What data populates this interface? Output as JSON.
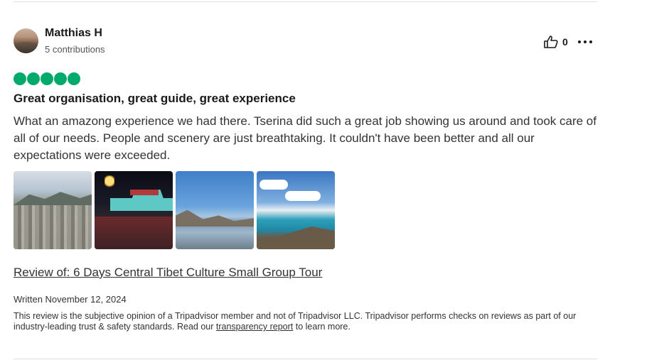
{
  "review": {
    "user": {
      "name": "Matthias H",
      "contributions": "5 contributions"
    },
    "helpful_count": "0",
    "rating": 5,
    "title": "Great organisation, great guide, great experience",
    "body": "What an amazong experience we had there. Tserina did such a great job showing us around and took care of all of our needs. People and scenery are just breathtaking. It couldn't have been better and all our expectations were exceeded.",
    "review_of": "Review of: 6 Days Central Tibet Culture Small Group Tour",
    "written": "Written November 12, 2024",
    "disclaimer": {
      "before_link": "This review is the subjective opinion of a Tripadvisor member and not of Tripadvisor LLC. Tripadvisor performs checks on reviews as part of our industry-leading trust & safety standards. Read our ",
      "link_text": "transparency report",
      "after_link": " to learn more."
    }
  },
  "icons": {
    "helpful": "thumbs-up-icon",
    "more": "more-options-icon",
    "rating": "rating-bubble-icon"
  },
  "colors": {
    "rating_green": "#00aa6c",
    "text": "#1a1a1a",
    "muted": "#555555"
  }
}
